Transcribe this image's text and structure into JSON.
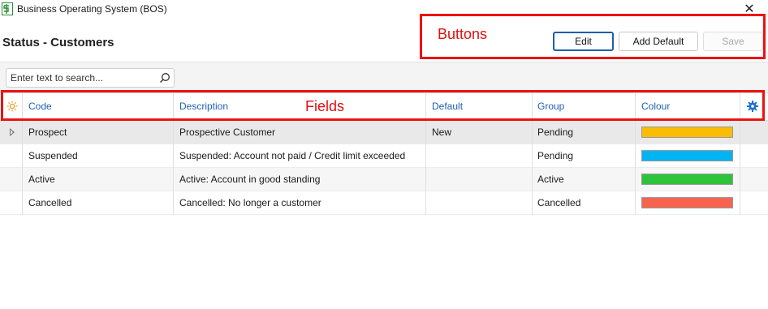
{
  "window": {
    "title": "Business Operating System (BOS)",
    "close_glyph": "✕"
  },
  "page": {
    "title": "Status - Customers"
  },
  "annotations": {
    "buttons_label": "Buttons",
    "fields_label": "Fields",
    "color": "#ee1111"
  },
  "toolbar": {
    "edit_label": "Edit",
    "add_default_label": "Add Default",
    "save_label": "Save"
  },
  "search": {
    "placeholder": "Enter text to search..."
  },
  "columns": {
    "code": "Code",
    "description": "Description",
    "default": "Default",
    "group": "Group",
    "colour": "Colour"
  },
  "rows": [
    {
      "code": "Prospect",
      "description": "Prospective Customer",
      "default": "New",
      "group": "Pending",
      "colour": "#fbbc04"
    },
    {
      "code": "Suspended",
      "description": "Suspended: Account not paid / Credit limit exceeded",
      "default": "",
      "group": "Pending",
      "colour": "#02b4f2"
    },
    {
      "code": "Active",
      "description": "Active: Account in good standing",
      "default": "",
      "group": "Active",
      "colour": "#2ec33a"
    },
    {
      "code": "Cancelled",
      "description": "Cancelled: No longer a customer",
      "default": "",
      "group": "Cancelled",
      "colour": "#f66450"
    }
  ],
  "icons": {
    "app": "bos-logo-icon",
    "close": "close-icon",
    "search": "search-icon",
    "new_row": "sun-icon",
    "settings": "gear-icon",
    "row_indicator": "current-row-icon"
  }
}
